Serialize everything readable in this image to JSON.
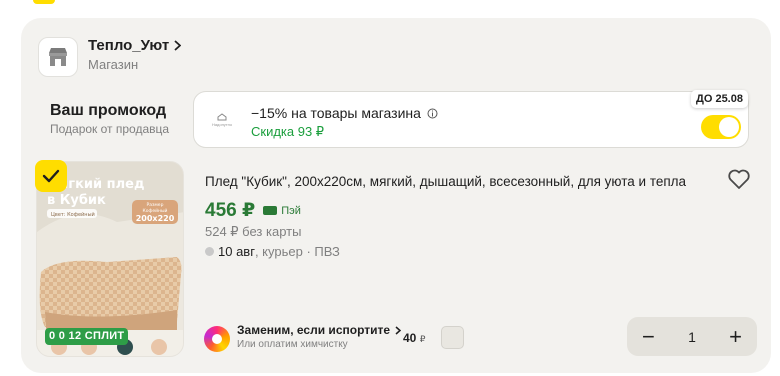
{
  "shop": {
    "name": "Тепло_Уют",
    "type": "Магазин"
  },
  "promo": {
    "title": "Ваш промокод",
    "subtitle": "Подарок от продавца",
    "text": "−15% на товары магазина",
    "discount": "Скидка 93 ₽",
    "badge": "ДО 25.08",
    "logo_caption": "Надопутно",
    "enabled": true
  },
  "product": {
    "title": "Плед \"Кубик\", 200х220см, мягкий, дышащий, всесезонный, для уюта и тепла",
    "price": "456 ₽",
    "pay_label": "Пэй",
    "old_price": "524 ₽ без карты",
    "delivery_date": "10 авг",
    "delivery_rest": ", курьер · ПВЗ",
    "split_badge": "0 0 12 СПЛИТ",
    "image_text_line1": "Мягкий плед",
    "image_text_line2": "в Кубик",
    "image_color": "Цвет: Кофейный",
    "image_size_label": "Размер",
    "image_size_color": "Кофейный",
    "image_size": "200x220",
    "selected": true
  },
  "service": {
    "title": "Заменим, если испортите",
    "subtitle": "Или оплатим химчистку",
    "price": "40",
    "currency": "₽"
  },
  "stepper": {
    "minus": "−",
    "quantity": "1",
    "plus": "+"
  },
  "colors": {
    "accent": "#ffdd00",
    "price_green": "#2a7a36",
    "discount_green": "#1a9e3c",
    "split_green": "#2e9d47",
    "card_bg": "#f3f2ef"
  }
}
